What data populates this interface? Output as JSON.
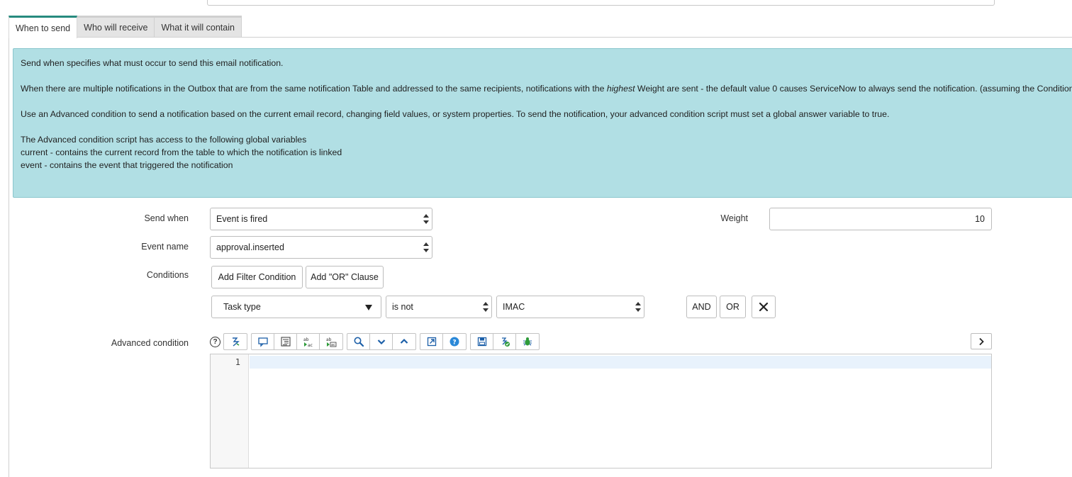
{
  "tabs": [
    {
      "label": "When to send",
      "active": true
    },
    {
      "label": "Who will receive",
      "active": false
    },
    {
      "label": "What it will contain",
      "active": false
    }
  ],
  "info": {
    "line1": "Send when specifies what must occur to send this email notification.",
    "line2_before": "When there are multiple notifications in the Outbox that are from the same notification Table and addressed to the same recipients, notifications with the ",
    "line2_emphasis": "highest",
    "line2_after": " Weight are sent - the default value 0 causes ServiceNow to always send the notification. (assuming the Conditions",
    "line3": "Use an Advanced condition to send a notification based on the current email record, changing field values, or system properties. To send the notification, your advanced condition script must set a global answer variable to true.",
    "line4": "The Advanced condition script has access to the following global variables",
    "line5": "current - contains the current record from the table to which the notification is linked",
    "line6": "event - contains the event that triggered the notification"
  },
  "form": {
    "send_when_label": "Send when",
    "send_when_value": "Event is fired",
    "weight_label": "Weight",
    "weight_value": "10",
    "event_name_label": "Event name",
    "event_name_value": "approval.inserted",
    "conditions_label": "Conditions",
    "add_filter_label": "Add Filter Condition",
    "add_or_label": "Add \"OR\" Clause",
    "condition": {
      "field": "Task type",
      "operator": "is not",
      "value": "IMAC",
      "and_label": "AND",
      "or_label": "OR"
    },
    "advanced_label": "Advanced condition",
    "help_glyph": "?",
    "editor_line_number": "1"
  },
  "toolbar": {
    "groups": [
      [
        "toggle-syntax-icon"
      ],
      [
        "comment-icon",
        "format-code-icon",
        "replace-icon",
        "replace-all-icon"
      ],
      [
        "search-icon",
        "collapse-icon",
        "expand-icon"
      ],
      [
        "open-fullscreen-icon",
        "help-icon"
      ],
      [
        "save-icon",
        "script-check-icon",
        "debug-icon"
      ]
    ]
  },
  "colors": {
    "info_bg": "#b1dfe4",
    "active_tab_accent": "#278a7e",
    "icon_blue": "#1c5fa8",
    "icon_green": "#2e9b3a"
  }
}
